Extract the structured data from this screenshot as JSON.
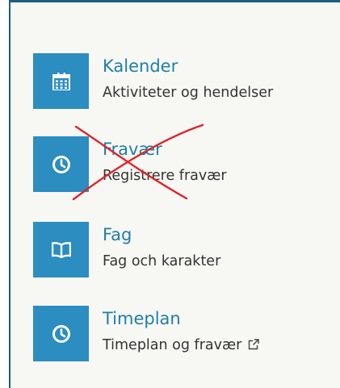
{
  "menu": {
    "items": [
      {
        "title": "Kalender",
        "subtitle": "Aktiviteter og hendelser",
        "icon": "calendar-icon"
      },
      {
        "title": "Fravær",
        "subtitle": "Registrere fravær",
        "icon": "clock-icon"
      },
      {
        "title": "Fag",
        "subtitle": "Fag och karakter",
        "icon": "book-icon"
      },
      {
        "title": "Timeplan",
        "subtitle": "Timeplan og fravær",
        "icon": "clock-icon",
        "trailing_icon": "external-link-icon"
      }
    ]
  },
  "colors": {
    "tile": "#2b8dc0",
    "title": "#1f7fa8",
    "frame_border": "#1b5f7e",
    "cross": "#e0232a"
  }
}
